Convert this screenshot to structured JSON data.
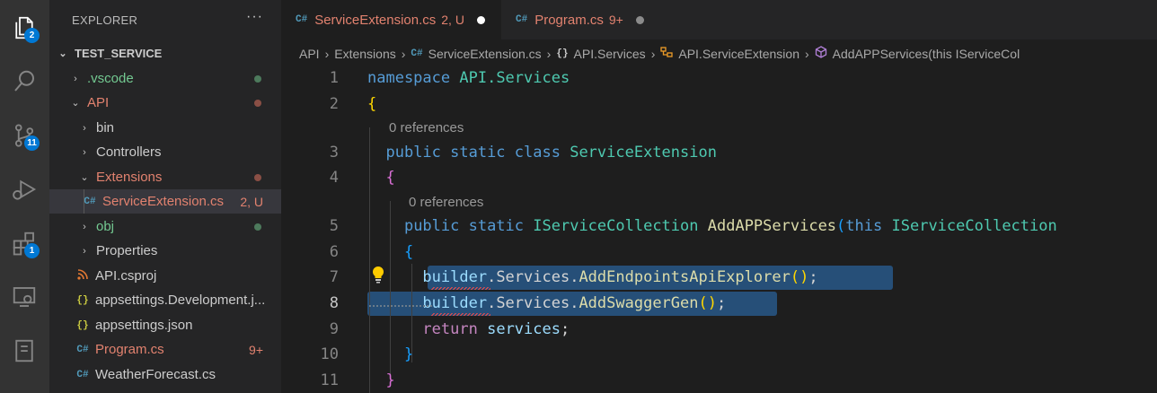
{
  "activity_bar": {
    "explorer_badge": "2",
    "scm_badge": "11",
    "extensions_badge": "1"
  },
  "sidebar": {
    "title": "EXPLORER",
    "more": "···",
    "root": "TEST_SERVICE",
    "items": [
      {
        "label": ".vscode",
        "chevron": "›",
        "color": "#73c991"
      },
      {
        "label": "API",
        "chevron": "⌄",
        "color": "#e2826f"
      },
      {
        "label": "bin",
        "chevron": "›",
        "color": "#cccccc"
      },
      {
        "label": "Controllers",
        "chevron": "›",
        "color": "#cccccc"
      },
      {
        "label": "Extensions",
        "chevron": "⌄",
        "color": "#e2826f"
      },
      {
        "label": "ServiceExtension.cs",
        "status": "2, U",
        "color": "#e2826f",
        "icon": "C#"
      },
      {
        "label": "obj",
        "chevron": "›",
        "color": "#73c991"
      },
      {
        "label": "Properties",
        "chevron": "›",
        "color": "#cccccc"
      },
      {
        "label": "API.csproj",
        "color": "#cccccc",
        "icon": "rss"
      },
      {
        "label": "appsettings.Development.j...",
        "color": "#cccccc",
        "icon": "{}"
      },
      {
        "label": "appsettings.json",
        "color": "#cccccc",
        "icon": "{}"
      },
      {
        "label": "Program.cs",
        "status": "9+",
        "color": "#e2826f",
        "icon": "C#"
      },
      {
        "label": "WeatherForecast.cs",
        "color": "#cccccc",
        "icon": "C#"
      }
    ]
  },
  "tabs": [
    {
      "label": "ServiceExtension.cs",
      "status": "2, U",
      "color": "#e2826f"
    },
    {
      "label": "Program.cs",
      "status": "9+",
      "color": "#e2826f"
    }
  ],
  "breadcrumb": {
    "p1": "API",
    "p2": "Extensions",
    "p3": "ServiceExtension.cs",
    "p4": "API.Services",
    "p5": "API.ServiceExtension",
    "p6": "AddAPPServices(this IServiceCol"
  },
  "editor": {
    "line_numbers": [
      "1",
      "2",
      "3",
      "4",
      "5",
      "6",
      "7",
      "8",
      "9",
      "10",
      "11"
    ],
    "lens1": "0 references",
    "lens2": "0 references",
    "code": {
      "l1_kw": "namespace",
      "l1_ns": "API.Services",
      "l3_kw": "public static class",
      "l3_type": "ServiceExtension",
      "l5_kw": "public static",
      "l5_type": "IServiceCollection",
      "l5_fn": "AddAPPServices",
      "l5_this": "this",
      "l5_type2": "IServiceCollection",
      "l7_var": "builder",
      "l7_mid": ".Services.",
      "l7_fn": "AddEndpointsApiExplorer",
      "l8_var": "builder",
      "l8_mid": ".Services.",
      "l8_fn": "AddSwaggerGen",
      "l9_kw": "return",
      "l9_var": "services"
    }
  }
}
